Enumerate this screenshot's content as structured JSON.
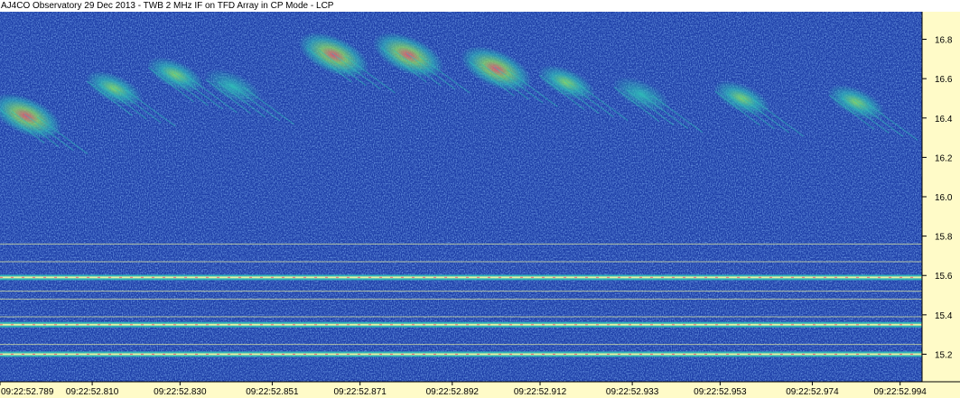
{
  "window": {
    "title": "AJ4CO Observatory 29 Dec 2013 - TWB 2 MHz IF on TFD Array in CP Mode - LCP"
  },
  "colors": {
    "background_noise": "#1e3fa8",
    "bright_noise": "#3d7ad8",
    "axis_panel": "#fffbc8",
    "burst_low": "#2fc0b8",
    "burst_mid": "#8fe060",
    "burst_high": "#f05070",
    "band_line": "#e8f0a0"
  },
  "chart_data": {
    "type": "heatmap",
    "title": "AJ4CO Observatory 29 Dec 2013 - TWB 2 MHz IF on TFD Array in CP Mode - LCP",
    "xlabel": "",
    "ylabel": "",
    "x_ticks": [
      "09:22:52.789",
      "09:22:52.810",
      "09:22:52.830",
      "09:22:52.851",
      "09:22:52.871",
      "09:22:52.892",
      "09:22:52.912",
      "09:22:52.933",
      "09:22:52.953",
      "09:22:52.974",
      "09:22:52.994"
    ],
    "y_ticks": [
      "15.2",
      "15.4",
      "15.6",
      "15.8",
      "16.0",
      "16.2",
      "16.4",
      "16.6",
      "16.8"
    ],
    "y_tick_values": [
      15.2,
      15.4,
      15.6,
      15.8,
      16.0,
      16.2,
      16.4,
      16.6,
      16.8
    ],
    "ylim": [
      15.06,
      16.94
    ],
    "xlim": [
      "09:22:52.789",
      "09:22:52.999"
    ],
    "y_unit": "MHz",
    "axis_side": "right",
    "grid": false,
    "legend": "none",
    "emission_bursts": [
      {
        "time": "09:22:52.795",
        "center_mhz": 16.41,
        "intensity": "high"
      },
      {
        "time": "09:22:52.815",
        "center_mhz": 16.55,
        "intensity": "medium"
      },
      {
        "time": "09:22:52.829",
        "center_mhz": 16.62,
        "intensity": "medium"
      },
      {
        "time": "09:22:52.842",
        "center_mhz": 16.56,
        "intensity": "low"
      },
      {
        "time": "09:22:52.865",
        "center_mhz": 16.72,
        "intensity": "high"
      },
      {
        "time": "09:22:52.882",
        "center_mhz": 16.72,
        "intensity": "high"
      },
      {
        "time": "09:22:52.902",
        "center_mhz": 16.65,
        "intensity": "high"
      },
      {
        "time": "09:22:52.918",
        "center_mhz": 16.58,
        "intensity": "medium"
      },
      {
        "time": "09:22:52.935",
        "center_mhz": 16.52,
        "intensity": "low"
      },
      {
        "time": "09:22:52.958",
        "center_mhz": 16.5,
        "intensity": "medium"
      },
      {
        "time": "09:22:52.984",
        "center_mhz": 16.48,
        "intensity": "medium"
      }
    ],
    "interference_bands": [
      {
        "center_mhz": 15.2,
        "intensity": "high"
      },
      {
        "center_mhz": 15.25,
        "intensity": "low"
      },
      {
        "center_mhz": 15.35,
        "intensity": "high"
      },
      {
        "center_mhz": 15.39,
        "intensity": "low"
      },
      {
        "center_mhz": 15.48,
        "intensity": "low"
      },
      {
        "center_mhz": 15.52,
        "intensity": "low"
      },
      {
        "center_mhz": 15.59,
        "intensity": "high"
      },
      {
        "center_mhz": 15.67,
        "intensity": "low"
      },
      {
        "center_mhz": 15.76,
        "intensity": "low"
      }
    ]
  }
}
